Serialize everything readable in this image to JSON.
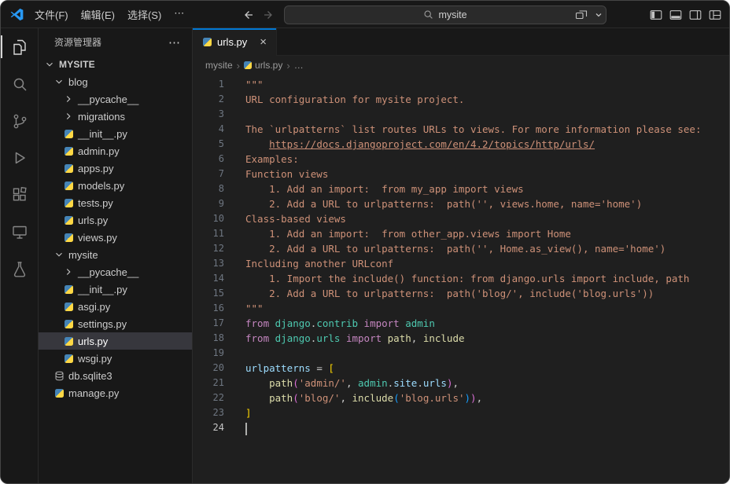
{
  "colors": {
    "accent": "#0078d4",
    "editor-bg": "#1f1f1f",
    "panel-bg": "#181818",
    "string": "#ce9178",
    "keyword": "#c586c0",
    "module": "#4ec9b0",
    "function": "#dcdcaa",
    "variable": "#9cdcfe",
    "python-blue": "#4584b6",
    "python-yellow": "#ffd845"
  },
  "title_bar": {
    "menus": [
      "文件(F)",
      "编辑(E)",
      "选择(S)",
      "⋯"
    ],
    "search_value": "mysite",
    "layout_icons": [
      {
        "name": "multi-window"
      },
      {
        "name": "chevron-down"
      },
      {
        "name": "gap"
      },
      {
        "name": "toggle-primary-sidebar"
      },
      {
        "name": "toggle-panel"
      },
      {
        "name": "toggle-secondary-sidebar"
      },
      {
        "name": "customize-layout"
      }
    ]
  },
  "activity_bar": {
    "items": [
      {
        "name": "explorer",
        "active": true
      },
      {
        "name": "search",
        "active": false
      },
      {
        "name": "source-control",
        "active": false
      },
      {
        "name": "run-debug",
        "active": false
      },
      {
        "name": "extensions",
        "active": false
      },
      {
        "name": "remote-explorer",
        "active": false
      },
      {
        "name": "testing",
        "active": false
      }
    ]
  },
  "sidebar": {
    "header": {
      "title": "资源管理器",
      "more_label": "⋯"
    },
    "tree": [
      {
        "label": "MYSITE",
        "type": "root",
        "indent": 0,
        "expanded": true
      },
      {
        "label": "blog",
        "type": "folder",
        "indent": 1,
        "expanded": true
      },
      {
        "label": "__pycache__",
        "type": "folder",
        "indent": 2,
        "expanded": false
      },
      {
        "label": "migrations",
        "type": "folder",
        "indent": 2,
        "expanded": false
      },
      {
        "label": "__init__.py",
        "type": "python",
        "indent": 2
      },
      {
        "label": "admin.py",
        "type": "python",
        "indent": 2
      },
      {
        "label": "apps.py",
        "type": "python",
        "indent": 2
      },
      {
        "label": "models.py",
        "type": "python",
        "indent": 2
      },
      {
        "label": "tests.py",
        "type": "python",
        "indent": 2
      },
      {
        "label": "urls.py",
        "type": "python",
        "indent": 2
      },
      {
        "label": "views.py",
        "type": "python",
        "indent": 2
      },
      {
        "label": "mysite",
        "type": "folder",
        "indent": 1,
        "expanded": true
      },
      {
        "label": "__pycache__",
        "type": "folder",
        "indent": 2,
        "expanded": false
      },
      {
        "label": "__init__.py",
        "type": "python",
        "indent": 2
      },
      {
        "label": "asgi.py",
        "type": "python",
        "indent": 2
      },
      {
        "label": "settings.py",
        "type": "python",
        "indent": 2
      },
      {
        "label": "urls.py",
        "type": "python",
        "indent": 2,
        "selected": true
      },
      {
        "label": "wsgi.py",
        "type": "python",
        "indent": 2
      },
      {
        "label": "db.sqlite3",
        "type": "database",
        "indent": 1
      },
      {
        "label": "manage.py",
        "type": "python",
        "indent": 1
      }
    ]
  },
  "editor": {
    "tabs": [
      {
        "label": "urls.py",
        "close": "×",
        "active": true
      }
    ],
    "breadcrumb": [
      {
        "label": "mysite"
      },
      {
        "label": "urls.py",
        "icon": "python"
      },
      {
        "label": "…"
      }
    ],
    "lines": [
      {
        "num": 1,
        "tokens": [
          {
            "t": "\"\"\"",
            "c": "str"
          }
        ]
      },
      {
        "num": 2,
        "tokens": [
          {
            "t": "URL configuration for mysite project.",
            "c": "str"
          }
        ]
      },
      {
        "num": 3,
        "tokens": []
      },
      {
        "num": 4,
        "tokens": [
          {
            "t": "The `urlpatterns` list routes URLs to views. For more information please see:",
            "c": "str"
          }
        ]
      },
      {
        "num": 5,
        "tokens": [
          {
            "t": "    ",
            "c": "str"
          },
          {
            "t": "https://docs.djangoproject.com/en/4.2/topics/http/urls/",
            "c": "link"
          }
        ]
      },
      {
        "num": 6,
        "tokens": [
          {
            "t": "Examples:",
            "c": "str"
          }
        ]
      },
      {
        "num": 7,
        "tokens": [
          {
            "t": "Function views",
            "c": "str"
          }
        ]
      },
      {
        "num": 8,
        "tokens": [
          {
            "t": "    1. Add an import:  from my_app import views",
            "c": "str"
          }
        ]
      },
      {
        "num": 9,
        "tokens": [
          {
            "t": "    2. Add a URL to urlpatterns:  path('', views.home, name='home')",
            "c": "str"
          }
        ]
      },
      {
        "num": 10,
        "tokens": [
          {
            "t": "Class-based views",
            "c": "str"
          }
        ]
      },
      {
        "num": 11,
        "tokens": [
          {
            "t": "    1. Add an import:  from other_app.views import Home",
            "c": "str"
          }
        ]
      },
      {
        "num": 12,
        "tokens": [
          {
            "t": "    2. Add a URL to urlpatterns:  path('', Home.as_view(), name='home')",
            "c": "str"
          }
        ]
      },
      {
        "num": 13,
        "tokens": [
          {
            "t": "Including another URLconf",
            "c": "str"
          }
        ]
      },
      {
        "num": 14,
        "tokens": [
          {
            "t": "    1. Import the include() function: from django.urls import include, path",
            "c": "str"
          }
        ]
      },
      {
        "num": 15,
        "tokens": [
          {
            "t": "    2. Add a URL to urlpatterns:  path('blog/', include('blog.urls'))",
            "c": "str"
          }
        ]
      },
      {
        "num": 16,
        "tokens": [
          {
            "t": "\"\"\"",
            "c": "str"
          }
        ]
      },
      {
        "num": 17,
        "tokens": [
          {
            "t": "from",
            "c": "kw"
          },
          {
            "t": " ",
            "c": "d"
          },
          {
            "t": "django",
            "c": "mod"
          },
          {
            "t": ".",
            "c": "d"
          },
          {
            "t": "contrib",
            "c": "mod"
          },
          {
            "t": " ",
            "c": "d"
          },
          {
            "t": "import",
            "c": "kw"
          },
          {
            "t": " ",
            "c": "d"
          },
          {
            "t": "admin",
            "c": "mod"
          }
        ]
      },
      {
        "num": 18,
        "tokens": [
          {
            "t": "from",
            "c": "kw"
          },
          {
            "t": " ",
            "c": "d"
          },
          {
            "t": "django",
            "c": "mod"
          },
          {
            "t": ".",
            "c": "d"
          },
          {
            "t": "urls",
            "c": "mod"
          },
          {
            "t": " ",
            "c": "d"
          },
          {
            "t": "import",
            "c": "kw"
          },
          {
            "t": " ",
            "c": "d"
          },
          {
            "t": "path",
            "c": "fn"
          },
          {
            "t": ", ",
            "c": "d"
          },
          {
            "t": "include",
            "c": "fn"
          }
        ]
      },
      {
        "num": 19,
        "tokens": []
      },
      {
        "num": 20,
        "tokens": [
          {
            "t": "urlpatterns",
            "c": "var"
          },
          {
            "t": " = ",
            "c": "d"
          },
          {
            "t": "[",
            "c": "br1"
          }
        ]
      },
      {
        "num": 21,
        "tokens": [
          {
            "t": "    ",
            "c": "d"
          },
          {
            "t": "path",
            "c": "fn"
          },
          {
            "t": "(",
            "c": "br2"
          },
          {
            "t": "'admin/'",
            "c": "str"
          },
          {
            "t": ", ",
            "c": "d"
          },
          {
            "t": "admin",
            "c": "mod"
          },
          {
            "t": ".",
            "c": "d"
          },
          {
            "t": "site",
            "c": "var"
          },
          {
            "t": ".",
            "c": "d"
          },
          {
            "t": "urls",
            "c": "var"
          },
          {
            "t": ")",
            "c": "br2"
          },
          {
            "t": ",",
            "c": "d"
          }
        ]
      },
      {
        "num": 22,
        "tokens": [
          {
            "t": "    ",
            "c": "d"
          },
          {
            "t": "path",
            "c": "fn"
          },
          {
            "t": "(",
            "c": "br2"
          },
          {
            "t": "'blog/'",
            "c": "str"
          },
          {
            "t": ", ",
            "c": "d"
          },
          {
            "t": "include",
            "c": "fn"
          },
          {
            "t": "(",
            "c": "br3"
          },
          {
            "t": "'blog.urls'",
            "c": "str"
          },
          {
            "t": ")",
            "c": "br3"
          },
          {
            "t": ")",
            "c": "br2"
          },
          {
            "t": ",",
            "c": "d"
          }
        ]
      },
      {
        "num": 23,
        "tokens": [
          {
            "t": "]",
            "c": "br1"
          }
        ]
      },
      {
        "num": 24,
        "tokens": [],
        "cursor": true,
        "current": true
      }
    ]
  }
}
